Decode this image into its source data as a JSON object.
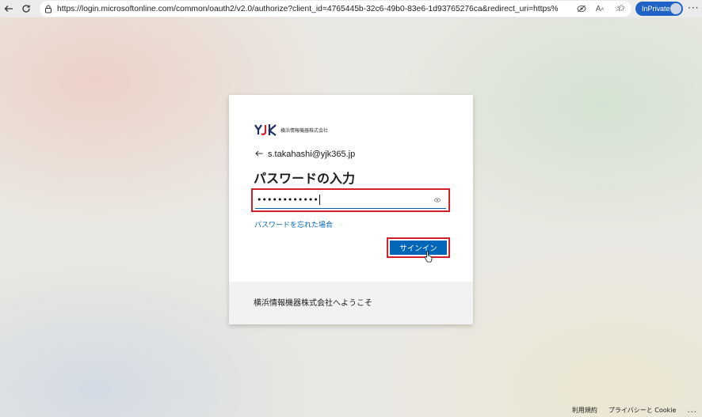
{
  "browser": {
    "url": "https://login.microsoftonline.com/common/oauth2/v2.0/authorize?client_id=4765445b-32c6-49b0-83e6-1d93765276ca&redirect_uri=https%3...",
    "inprivate_label": "InPrivate",
    "icons": [
      "back-icon",
      "refresh-icon",
      "lock-icon",
      "tracking-prevention-icon",
      "read-aloud-icon",
      "favorite-star-icon",
      "favorites-icon",
      "profile-icon",
      "more-icon"
    ]
  },
  "card": {
    "company_name": "横浜情報機器株式会社",
    "email": "s.takahashi@yjk365.jp",
    "heading": "パスワードの入力",
    "password_value": "••••••••••••",
    "forgot_link": "パスワードを忘れた場合",
    "signin_button": "サインイン",
    "welcome_text": "横浜情報機器株式会社へようこそ"
  },
  "footer": {
    "terms": "利用規約",
    "privacy": "プライバシーと Cookie",
    "more": "..."
  },
  "colors": {
    "accent": "#0067b8",
    "highlight": "#d2202d",
    "inprivate": "#1f63c6",
    "logo_navy": "#1a2e6e",
    "logo_red": "#d2202d"
  }
}
